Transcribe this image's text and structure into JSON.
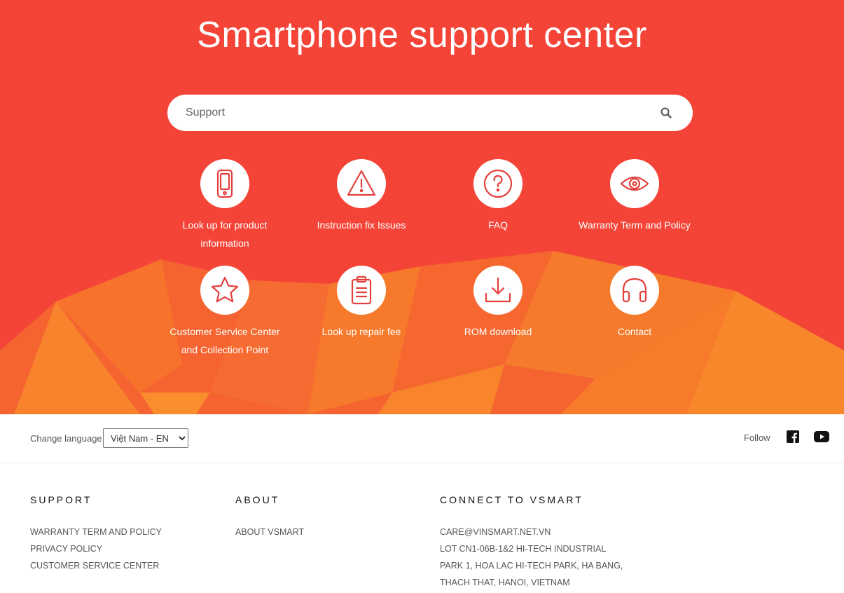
{
  "hero": {
    "title": "Smartphone support center",
    "search": {
      "placeholder": "Support",
      "value": ""
    }
  },
  "tiles": [
    {
      "label": "Look up for product information",
      "icon": "smartphone-icon"
    },
    {
      "label": "Instruction fix Issues",
      "icon": "warning-icon"
    },
    {
      "label": "FAQ",
      "icon": "question-icon"
    },
    {
      "label": "Warranty Term and Policy",
      "icon": "eye-icon"
    },
    {
      "label": "Customer Service Center and Collection Point",
      "icon": "star-icon"
    },
    {
      "label": "Look up repair fee",
      "icon": "clipboard-icon"
    },
    {
      "label": "ROM download",
      "icon": "download-icon"
    },
    {
      "label": "Contact",
      "icon": "headphones-icon"
    }
  ],
  "language": {
    "label": "Change language",
    "selected": "Việt Nam - EN"
  },
  "follow": {
    "label": "Follow",
    "icons": [
      "facebook-icon",
      "youtube-icon"
    ]
  },
  "footer": {
    "support": {
      "heading": "SUPPORT",
      "links": [
        "WARRANTY TERM AND POLICY",
        "PRIVACY POLICY",
        "CUSTOMER SERVICE CENTER"
      ]
    },
    "about": {
      "heading": "ABOUT",
      "links": [
        "ABOUT VSMART"
      ]
    },
    "connect": {
      "heading": "CONNECT TO VSMART",
      "email": "CARE@VINSMART.NET.VN",
      "address_lines": [
        "LOT CN1-06B-1&2 HI-TECH INDUSTRIAL",
        "PARK 1, HOA LAC HI-TECH PARK, HA BANG,",
        "THACH THAT, HANOI, VIETNAM"
      ]
    }
  },
  "colors": {
    "hero_red": "#f34437",
    "hero_orange": "#f7782a",
    "icon_stroke": "#e3403c"
  }
}
